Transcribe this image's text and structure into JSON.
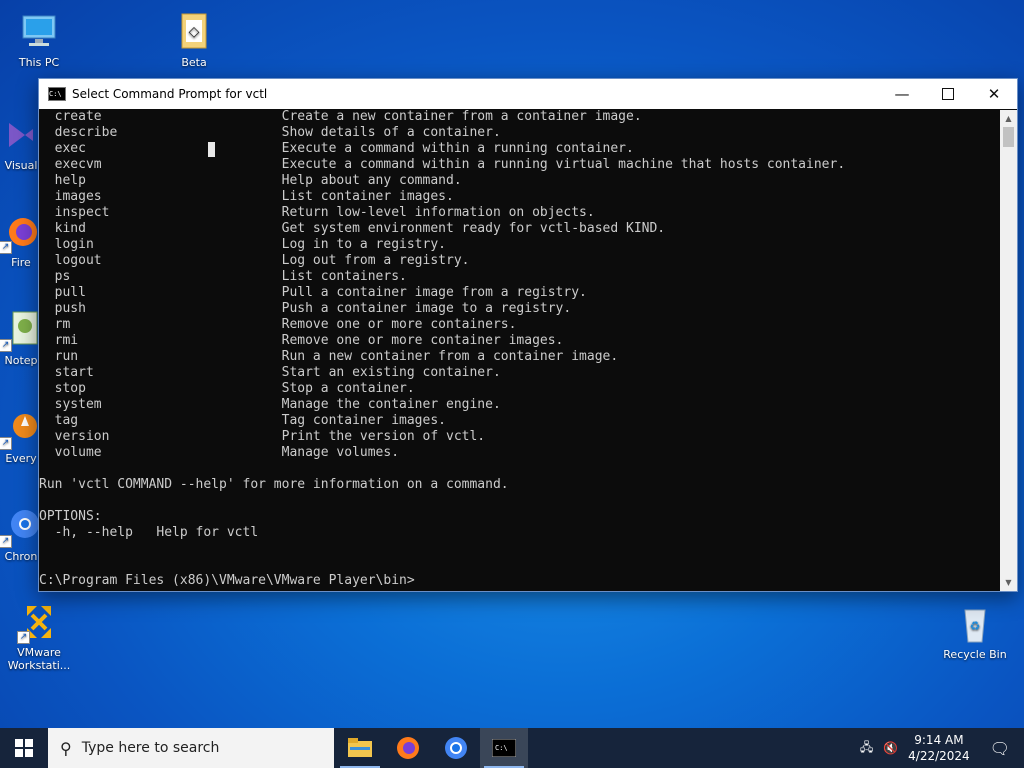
{
  "desktop": {
    "icons": [
      {
        "label": "This PC"
      },
      {
        "label": "Beta"
      },
      {
        "label": "Visual"
      },
      {
        "label": "Fire"
      },
      {
        "label": "Notep"
      },
      {
        "label": "Every"
      },
      {
        "label": "Chron"
      },
      {
        "label": "VMware Workstati..."
      },
      {
        "label": "Recycle Bin"
      }
    ]
  },
  "window": {
    "title": "Select Command Prompt for vctl",
    "console_text": "  create                       Create a new container from a container image.\n  describe                     Show details of a container.\n  exec                         Execute a command within a running container.\n  execvm                       Execute a command within a running virtual machine that hosts container.\n  help                         Help about any command.\n  images                       List container images.\n  inspect                      Return low-level information on objects.\n  kind                         Get system environment ready for vctl-based KIND.\n  login                        Log in to a registry.\n  logout                       Log out from a registry.\n  ps                           List containers.\n  pull                         Pull a container image from a registry.\n  push                         Push a container image to a registry.\n  rm                           Remove one or more containers.\n  rmi                          Remove one or more container images.\n  run                          Run a new container from a container image.\n  start                        Start an existing container.\n  stop                         Stop a container.\n  system                       Manage the container engine.\n  tag                          Tag container images.\n  version                      Print the version of vctl.\n  volume                       Manage volumes.\n\nRun 'vctl COMMAND --help' for more information on a command.\n\nOPTIONS:\n  -h, --help   Help for vctl\n\n\nC:\\Program Files (x86)\\VMware\\VMware Player\\bin>"
  },
  "taskbar": {
    "search_placeholder": "Type here to search",
    "time": "9:14 AM",
    "date": "4/22/2024"
  },
  "colors": {
    "console_bg": "#0c0c0c",
    "console_fg": "#cccccc",
    "taskbar_bg": "#16243b"
  }
}
